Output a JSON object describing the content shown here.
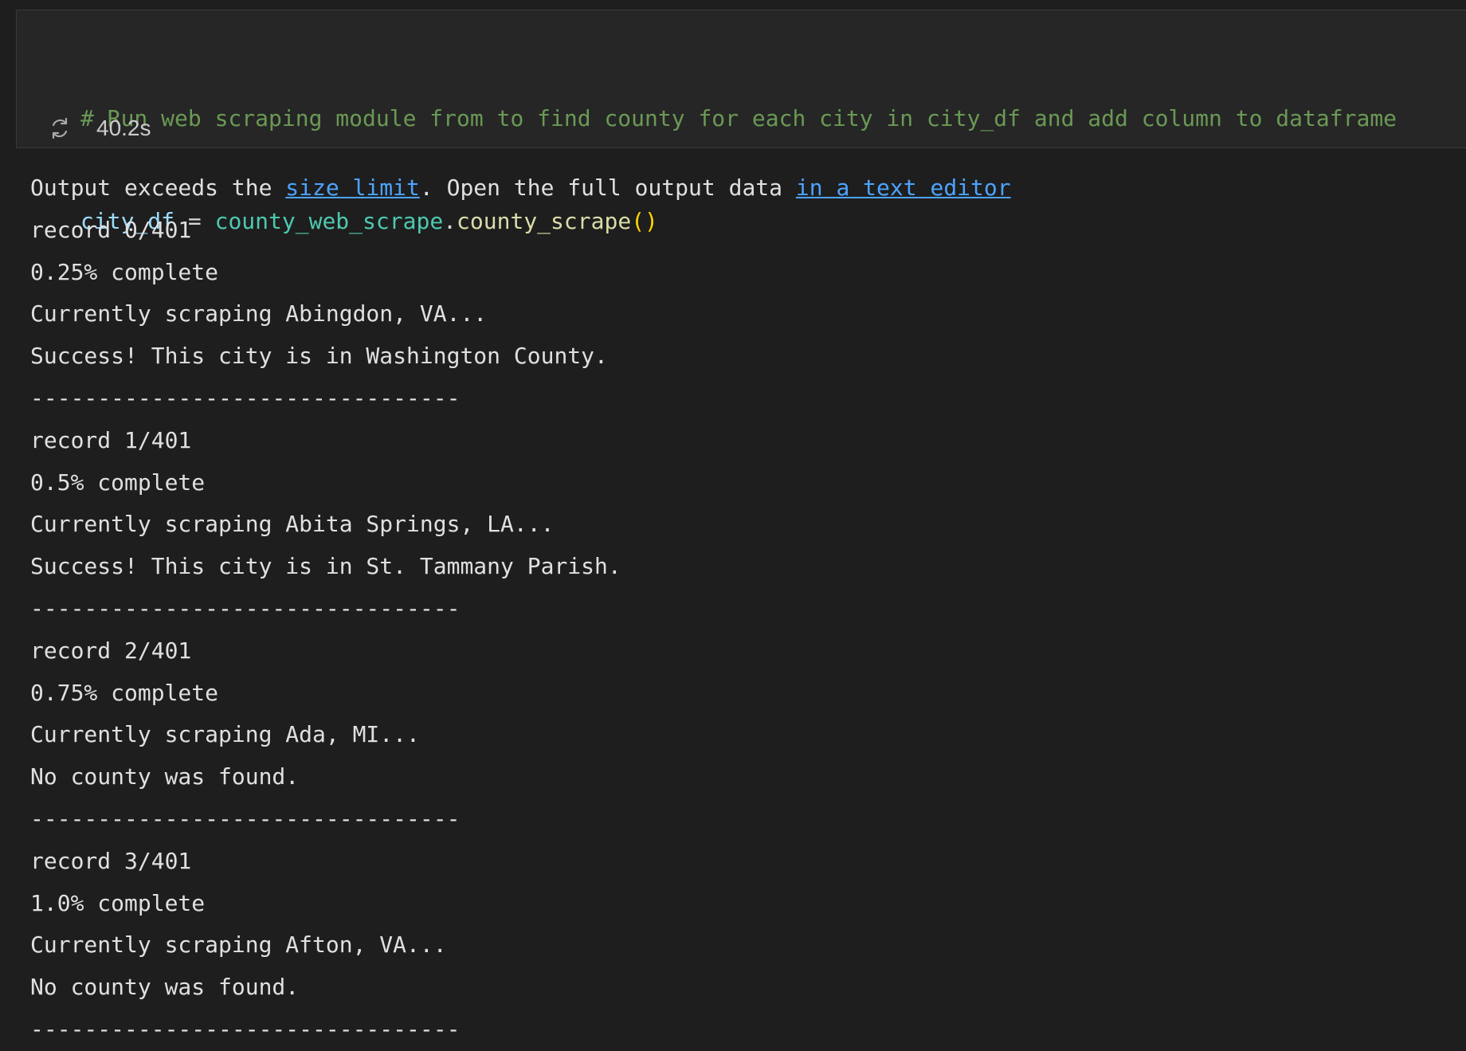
{
  "cell": {
    "code_lines": {
      "comment": "# Run web scraping module from to find county for each city in city_df and add column to dataframe",
      "var": "city_df",
      "op": " = ",
      "module": "county_web_scrape",
      "dot": ".",
      "func": "county_scrape",
      "parens": "()"
    },
    "status": {
      "icon": "refresh-icon",
      "duration": "40.2s"
    }
  },
  "output": {
    "notice": {
      "prefix": "Output exceeds the ",
      "link1": "size limit",
      "middle": ". Open the full output data ",
      "link2": "in a text editor"
    },
    "lines": [
      "record 0/401",
      "0.25% complete",
      "Currently scraping Abingdon, VA...",
      "Success! This city is in Washington County.",
      "--------------------------------",
      "record 1/401",
      "0.5% complete",
      "Currently scraping Abita Springs, LA...",
      "Success! This city is in St. Tammany Parish.",
      "--------------------------------",
      "record 2/401",
      "0.75% complete",
      "Currently scraping Ada, MI...",
      "No county was found.",
      "--------------------------------",
      "record 3/401",
      "1.0% complete",
      "Currently scraping Afton, VA...",
      "No county was found.",
      "--------------------------------"
    ]
  },
  "colors": {
    "background": "#1e1e1e",
    "cell_background": "#262626",
    "comment": "#6a9955",
    "variable": "#9cdcfe",
    "module": "#4ec9b0",
    "function": "#dcdcaa",
    "link": "#4da3ff"
  }
}
